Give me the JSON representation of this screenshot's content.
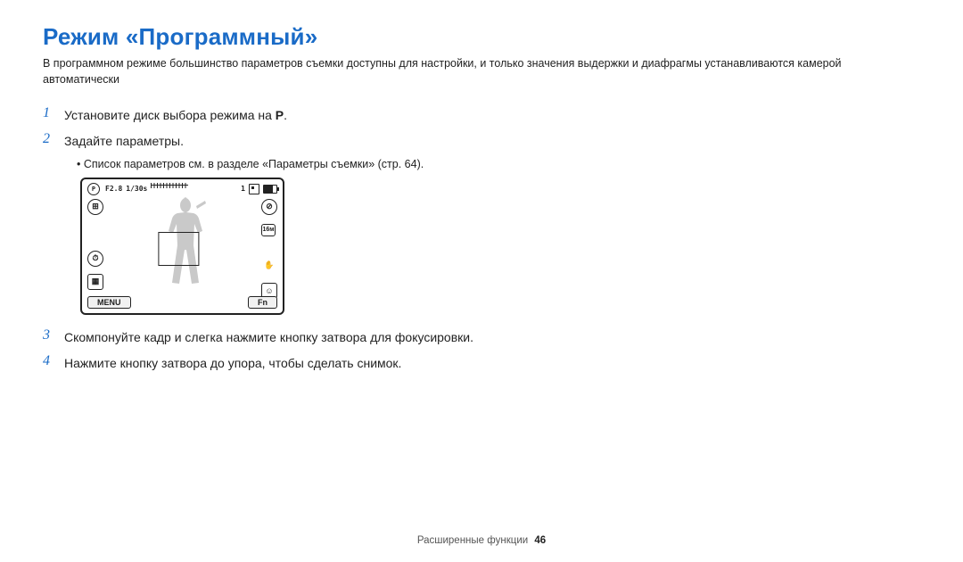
{
  "title": "Режим «Программный»",
  "intro": "В программном режиме большинство параметров съемки доступны для настройки, и только значения выдержки и диафрагмы устанавливаются камерой автоматически",
  "steps": {
    "s1": {
      "num": "1",
      "pre": "Установите диск выбора режима на ",
      "mode": "P",
      "post": "."
    },
    "s2": {
      "num": "2",
      "text": "Задайте параметры."
    },
    "s2_sub": "Список параметров см. в разделе «Параметры съемки» (стр. 64).",
    "s3": {
      "num": "3",
      "text": "Скомпонуйте кадр и слегка нажмите кнопку затвора для фокусировки."
    },
    "s4": {
      "num": "4",
      "text": "Нажмите кнопку затвора до упора, чтобы сделать снимок."
    }
  },
  "lcd": {
    "aperture": "F2.8",
    "shutter": "1/30s",
    "count": "1",
    "menu": "MENU",
    "fn": "Fn",
    "icons": {
      "mode": "P",
      "drive": "⊞",
      "timer": "⏱",
      "flash": "⊘",
      "size": "16м",
      "stab": "✋",
      "face": "☺"
    }
  },
  "footer": {
    "section": "Расширенные функции",
    "page": "46"
  }
}
